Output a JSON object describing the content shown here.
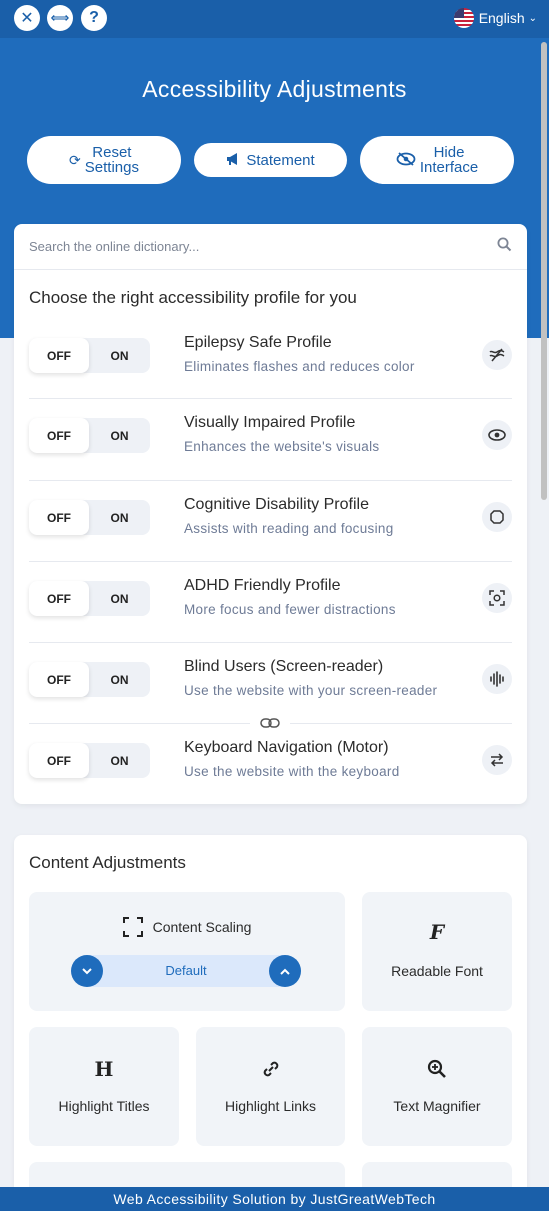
{
  "topbar": {
    "close_glyph": "✕",
    "expand_glyph": "⟺",
    "help_glyph": "?",
    "language": "English",
    "language_chevron": "⌄"
  },
  "header": {
    "title": "Accessibility Adjustments",
    "buttons": {
      "reset_line1": "Reset",
      "reset_line2": "Settings",
      "statement": "Statement",
      "hide_line1": "Hide",
      "hide_line2": "Interface"
    }
  },
  "search": {
    "placeholder": "Search the online dictionary..."
  },
  "profiles": {
    "heading": "Choose the right accessibility profile for you",
    "off_label": "OFF",
    "on_label": "ON",
    "items": [
      {
        "title": "Epilepsy Safe Profile",
        "desc": "Eliminates flashes and reduces color",
        "icon": "epilepsy-icon"
      },
      {
        "title": "Visually Impaired Profile",
        "desc": "Enhances the website's visuals",
        "icon": "eye-icon"
      },
      {
        "title": "Cognitive Disability Profile",
        "desc": "Assists with reading and focusing",
        "icon": "brain-icon"
      },
      {
        "title": "ADHD Friendly Profile",
        "desc": "More focus and fewer distractions",
        "icon": "focus-icon"
      },
      {
        "title": "Blind Users (Screen-reader)",
        "desc": "Use the website with your screen-reader",
        "icon": "audio-icon"
      },
      {
        "title": "Keyboard Navigation (Motor)",
        "desc": "Use the website with the keyboard",
        "icon": "arrows-icon"
      }
    ]
  },
  "content": {
    "heading": "Content Adjustments",
    "scaling_label": "Content Scaling",
    "scaling_value": "Default",
    "readable_font": "Readable Font",
    "highlight_titles": "Highlight Titles",
    "highlight_links": "Highlight Links",
    "text_magnifier": "Text Magnifier"
  },
  "footer": {
    "text": "Web Accessibility Solution by JustGreatWebTech"
  },
  "colors": {
    "primary": "#1f6cbc",
    "topbar": "#1a5fa9",
    "tile_bg": "#f1f4f8"
  }
}
